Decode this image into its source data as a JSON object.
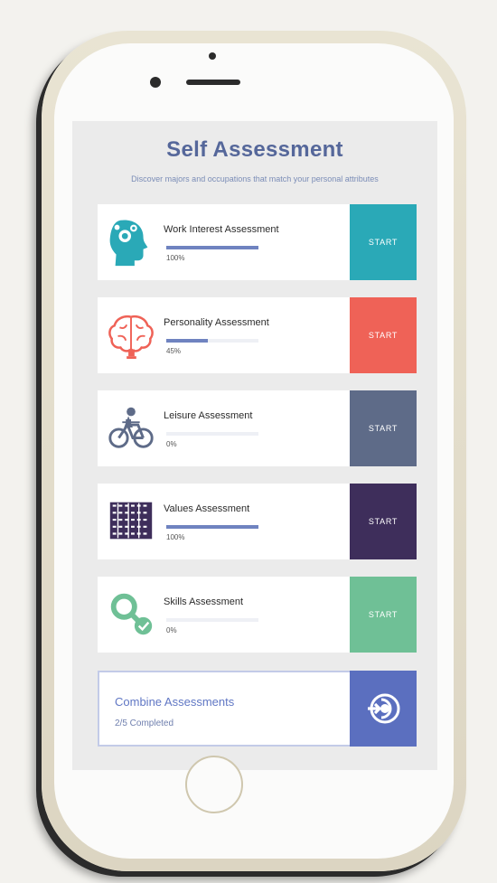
{
  "page": {
    "title": "Self Assessment",
    "subtitle": "Discover majors and occupations that match your personal attributes"
  },
  "assessments": [
    {
      "title": "Work Interest Assessment",
      "progress_label": "100%",
      "progress": 1.0,
      "button_label": "START",
      "accent": "#2aa9b7",
      "icon": "head-gear-icon"
    },
    {
      "title": "Personality Assessment",
      "progress_label": "45%",
      "progress": 0.45,
      "button_label": "START",
      "accent": "#ef6257",
      "icon": "brain-icon"
    },
    {
      "title": "Leisure Assessment",
      "progress_label": "0%",
      "progress": 0.0,
      "button_label": "START",
      "accent": "#5e6b88",
      "icon": "bicycle-icon"
    },
    {
      "title": "Values Assessment",
      "progress_label": "100%",
      "progress": 1.0,
      "button_label": "START",
      "accent": "#3e2e5b",
      "icon": "cards-icon"
    },
    {
      "title": "Skills Assessment",
      "progress_label": "0%",
      "progress": 0.0,
      "button_label": "START",
      "accent": "#6fc096",
      "icon": "magnifier-icon"
    }
  ],
  "combine": {
    "title": "Combine Assessments",
    "status": "2/5 Completed",
    "accent": "#5b6fbf",
    "icon": "combine-arrow-icon"
  }
}
